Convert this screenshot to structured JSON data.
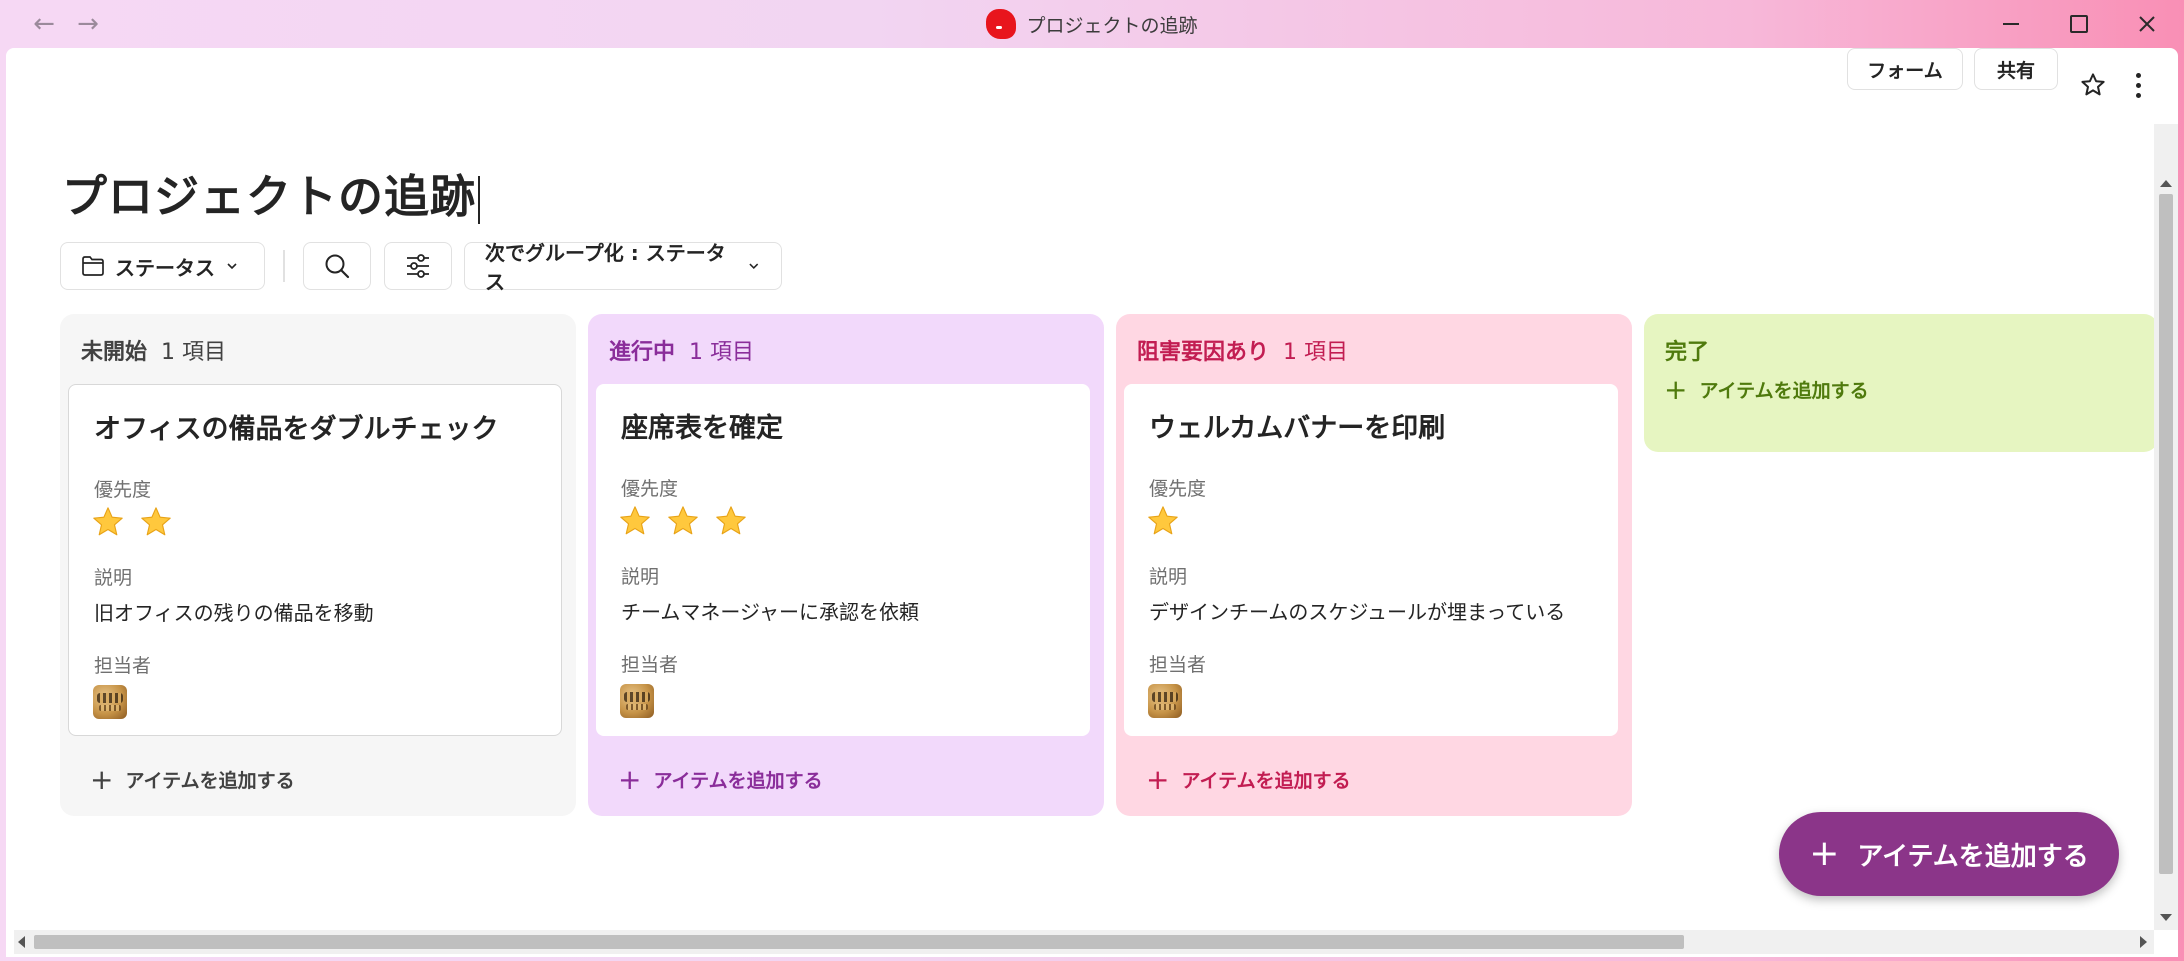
{
  "window": {
    "title": "プロジェクトの追跡"
  },
  "header": {
    "form_label": "フォーム",
    "share_label": "共有"
  },
  "page": {
    "title": "プロジェクトの追跡"
  },
  "toolbar": {
    "status_label": "ステータス",
    "group_by_label": "次でグループ化 : ステータス"
  },
  "labels": {
    "priority": "優先度",
    "description": "説明",
    "assignee": "担当者",
    "add_item": "アイテムを追加する"
  },
  "columns": [
    {
      "name": "未開始",
      "count": "1 項目",
      "color": "#f6f6f6",
      "card": {
        "title": "オフィスの備品をダブルチェック",
        "priority_stars": 2,
        "description": "旧オフィスの残りの備品を移動"
      }
    },
    {
      "name": "進行中",
      "count": "1 項目",
      "color": "#f2d9fb",
      "card": {
        "title": "座席表を確定",
        "priority_stars": 3,
        "description": "チームマネージャーに承認を依頼"
      }
    },
    {
      "name": "阻害要因あり",
      "count": "1 項目",
      "color": "#ffd7e3",
      "card": {
        "title": "ウェルカムバナーを印刷",
        "priority_stars": 1,
        "description": "デザインチームのスケジュールが埋まっている"
      }
    },
    {
      "name": "完了",
      "count": "",
      "color": "#e6f5c1"
    }
  ],
  "fab": {
    "label": "アイテムを追加する",
    "color": "#8b3589"
  },
  "icons": {
    "back": "arrow-left-icon",
    "forward": "arrow-right-icon",
    "folder": "folder-icon",
    "search": "search-icon",
    "filter": "sliders-icon",
    "favorite": "star-outline-icon",
    "more": "more-vertical-icon"
  }
}
